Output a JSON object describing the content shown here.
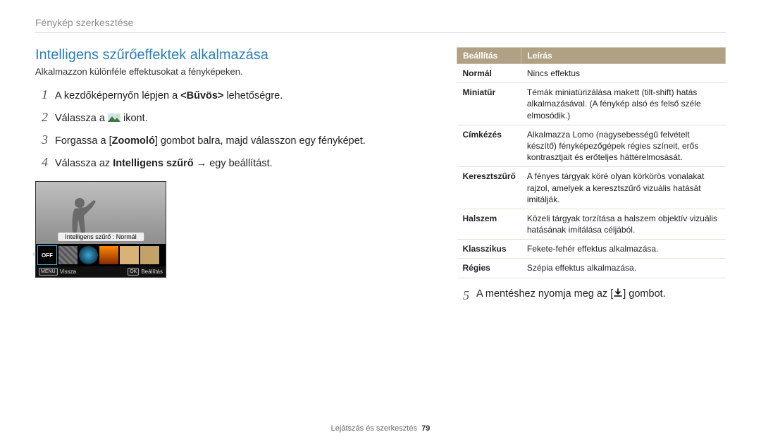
{
  "breadcrumb": "Fénykép szerkesztése",
  "section_title": "Intelligens szűrőeffektek alkalmazása",
  "lead": "Alkalmazzon különféle effektusokat a fényképeken.",
  "steps_left": [
    {
      "n": "1",
      "pre": "A kezdőképernyőn lépjen a ",
      "bold": "<Bűvös>",
      "post": " lehetőségre."
    },
    {
      "n": "2",
      "pre": "Válassza a ",
      "icon": true,
      "post": " ikont."
    },
    {
      "n": "3",
      "pre": "Forgassa a [",
      "bold": "Zoomoló",
      "post": "] gombot balra, majd válasszon egy fényképet."
    },
    {
      "n": "4",
      "pre": "Válassza az ",
      "bold": "Intelligens szűrő",
      "post": " → egy beállítást."
    }
  ],
  "preview": {
    "filter_label": "Intelligens szűrő : Normál",
    "off": "OFF",
    "back_key": "MENU",
    "back_label": "Vissza",
    "set_key": "OK",
    "set_label": "Beállítás"
  },
  "table": {
    "head_opt": "Beállítás",
    "head_desc": "Leírás",
    "rows": [
      {
        "opt": "Normál",
        "desc": "Nincs effektus"
      },
      {
        "opt": "Miniatűr",
        "desc": "Témák miniatürizálása makett (tilt-shift) hatás alkalmazásával. (A fénykép alsó és felső széle elmosódik.)"
      },
      {
        "opt": "Címkézés",
        "desc": "Alkalmazza Lomo (nagysebességű felvételt készítő) fényképezőgépek régies színeit, erős kontrasztjait és erőteljes háttérelmosását."
      },
      {
        "opt": "Keresztszűrő",
        "desc": "A fényes tárgyak köré olyan körkörös vonalakat rajzol, amelyek a keresztszűrő vizuális hatását imitálják."
      },
      {
        "opt": "Halszem",
        "desc": "Közeli tárgyak torzítása a halszem objektív vizuális hatásának imitálása céljából."
      },
      {
        "opt": "Klasszikus",
        "desc": "Fekete-fehér effektus alkalmazása."
      },
      {
        "opt": "Régies",
        "desc": "Szépia effektus alkalmazása."
      }
    ]
  },
  "step_right": {
    "n": "5",
    "pre": "A mentéshez nyomja meg az [",
    "post": "] gombot."
  },
  "footer": {
    "chapter": "Lejátszás és szerkesztés",
    "page": "79"
  }
}
